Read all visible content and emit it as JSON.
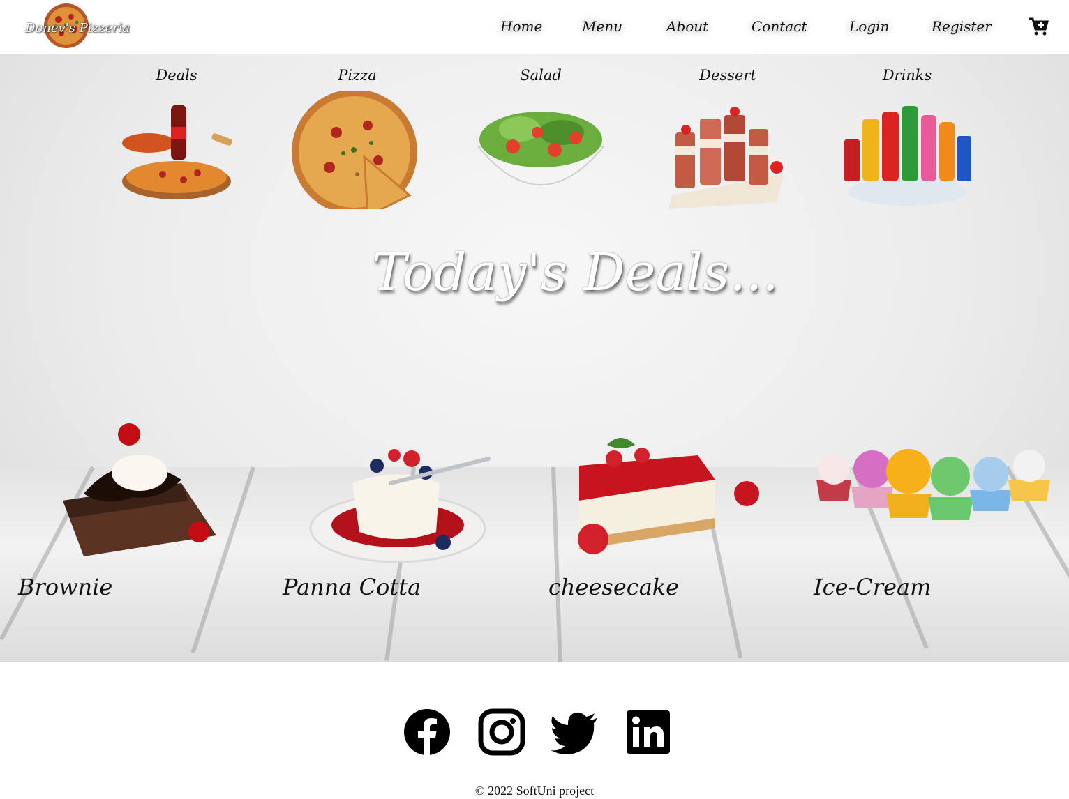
{
  "brand": {
    "name": "Donev's Pizzeria"
  },
  "nav": {
    "home": "Home",
    "menu": "Menu",
    "about": "About",
    "contact": "Contact",
    "login": "Login",
    "register": "Register",
    "cart_icon": "cart-plus-icon"
  },
  "categories": [
    {
      "label": "Deals"
    },
    {
      "label": "Pizza"
    },
    {
      "label": "Salad"
    },
    {
      "label": "Dessert"
    },
    {
      "label": "Drinks"
    }
  ],
  "headline": "Today's Deals...",
  "desserts": [
    {
      "label": "Brownie"
    },
    {
      "label": "Panna Cotta"
    },
    {
      "label": "cheesecake"
    },
    {
      "label": "Ice-Cream"
    }
  ],
  "footer": {
    "social": [
      "facebook-icon",
      "instagram-icon",
      "twitter-icon",
      "linkedin-icon"
    ],
    "copyright": "© 2022 SoftUni project"
  },
  "colors": {
    "text": "#111111",
    "background": "#ffffff",
    "accent": "#c62828"
  }
}
